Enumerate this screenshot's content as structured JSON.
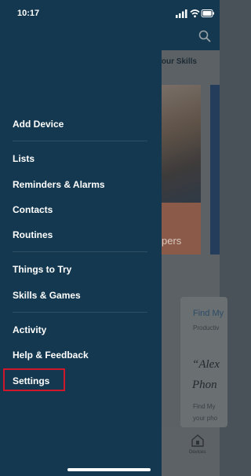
{
  "status_bar": {
    "time": "10:17"
  },
  "background": {
    "section_title": "Your Skills",
    "card_orange_text": "pers",
    "card_find_text": "Find My",
    "card_productive_text": "Productiv",
    "quote_line1": "“Alex",
    "quote_line2": "Phon",
    "card_desc_line1": "Find My",
    "card_desc_line2": "your pho",
    "tab_devices_label": "Devices"
  },
  "drawer": {
    "items": [
      {
        "label": "Add Device"
      },
      {
        "label": "Lists"
      },
      {
        "label": "Reminders & Alarms"
      },
      {
        "label": "Contacts"
      },
      {
        "label": "Routines"
      },
      {
        "label": "Things to Try"
      },
      {
        "label": "Skills & Games"
      },
      {
        "label": "Activity"
      },
      {
        "label": "Help & Feedback"
      },
      {
        "label": "Settings"
      }
    ],
    "highlighted_item": "Settings",
    "highlight_color": "#d0162a",
    "background_color": "#14384f"
  }
}
